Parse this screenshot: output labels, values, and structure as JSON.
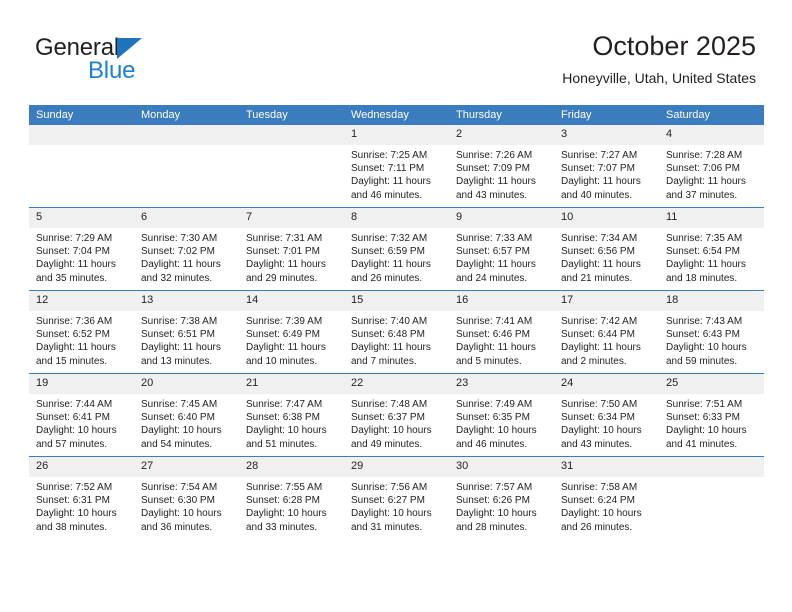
{
  "brand": {
    "name_part1": "General",
    "name_part2": "Blue",
    "logo_color": "#1b82d2"
  },
  "header": {
    "title": "October 2025",
    "subtitle": "Honeyville, Utah, United States",
    "accent_color": "#3a7cbe"
  },
  "weekdays": [
    "Sunday",
    "Monday",
    "Tuesday",
    "Wednesday",
    "Thursday",
    "Friday",
    "Saturday"
  ],
  "weeks": [
    [
      {
        "day": "",
        "sunrise": "",
        "sunset": "",
        "daylight": "",
        "daylight2": ""
      },
      {
        "day": "",
        "sunrise": "",
        "sunset": "",
        "daylight": "",
        "daylight2": ""
      },
      {
        "day": "",
        "sunrise": "",
        "sunset": "",
        "daylight": "",
        "daylight2": ""
      },
      {
        "day": "1",
        "sunrise": "Sunrise: 7:25 AM",
        "sunset": "Sunset: 7:11 PM",
        "daylight": "Daylight: 11 hours",
        "daylight2": "and 46 minutes."
      },
      {
        "day": "2",
        "sunrise": "Sunrise: 7:26 AM",
        "sunset": "Sunset: 7:09 PM",
        "daylight": "Daylight: 11 hours",
        "daylight2": "and 43 minutes."
      },
      {
        "day": "3",
        "sunrise": "Sunrise: 7:27 AM",
        "sunset": "Sunset: 7:07 PM",
        "daylight": "Daylight: 11 hours",
        "daylight2": "and 40 minutes."
      },
      {
        "day": "4",
        "sunrise": "Sunrise: 7:28 AM",
        "sunset": "Sunset: 7:06 PM",
        "daylight": "Daylight: 11 hours",
        "daylight2": "and 37 minutes."
      }
    ],
    [
      {
        "day": "5",
        "sunrise": "Sunrise: 7:29 AM",
        "sunset": "Sunset: 7:04 PM",
        "daylight": "Daylight: 11 hours",
        "daylight2": "and 35 minutes."
      },
      {
        "day": "6",
        "sunrise": "Sunrise: 7:30 AM",
        "sunset": "Sunset: 7:02 PM",
        "daylight": "Daylight: 11 hours",
        "daylight2": "and 32 minutes."
      },
      {
        "day": "7",
        "sunrise": "Sunrise: 7:31 AM",
        "sunset": "Sunset: 7:01 PM",
        "daylight": "Daylight: 11 hours",
        "daylight2": "and 29 minutes."
      },
      {
        "day": "8",
        "sunrise": "Sunrise: 7:32 AM",
        "sunset": "Sunset: 6:59 PM",
        "daylight": "Daylight: 11 hours",
        "daylight2": "and 26 minutes."
      },
      {
        "day": "9",
        "sunrise": "Sunrise: 7:33 AM",
        "sunset": "Sunset: 6:57 PM",
        "daylight": "Daylight: 11 hours",
        "daylight2": "and 24 minutes."
      },
      {
        "day": "10",
        "sunrise": "Sunrise: 7:34 AM",
        "sunset": "Sunset: 6:56 PM",
        "daylight": "Daylight: 11 hours",
        "daylight2": "and 21 minutes."
      },
      {
        "day": "11",
        "sunrise": "Sunrise: 7:35 AM",
        "sunset": "Sunset: 6:54 PM",
        "daylight": "Daylight: 11 hours",
        "daylight2": "and 18 minutes."
      }
    ],
    [
      {
        "day": "12",
        "sunrise": "Sunrise: 7:36 AM",
        "sunset": "Sunset: 6:52 PM",
        "daylight": "Daylight: 11 hours",
        "daylight2": "and 15 minutes."
      },
      {
        "day": "13",
        "sunrise": "Sunrise: 7:38 AM",
        "sunset": "Sunset: 6:51 PM",
        "daylight": "Daylight: 11 hours",
        "daylight2": "and 13 minutes."
      },
      {
        "day": "14",
        "sunrise": "Sunrise: 7:39 AM",
        "sunset": "Sunset: 6:49 PM",
        "daylight": "Daylight: 11 hours",
        "daylight2": "and 10 minutes."
      },
      {
        "day": "15",
        "sunrise": "Sunrise: 7:40 AM",
        "sunset": "Sunset: 6:48 PM",
        "daylight": "Daylight: 11 hours",
        "daylight2": "and 7 minutes."
      },
      {
        "day": "16",
        "sunrise": "Sunrise: 7:41 AM",
        "sunset": "Sunset: 6:46 PM",
        "daylight": "Daylight: 11 hours",
        "daylight2": "and 5 minutes."
      },
      {
        "day": "17",
        "sunrise": "Sunrise: 7:42 AM",
        "sunset": "Sunset: 6:44 PM",
        "daylight": "Daylight: 11 hours",
        "daylight2": "and 2 minutes."
      },
      {
        "day": "18",
        "sunrise": "Sunrise: 7:43 AM",
        "sunset": "Sunset: 6:43 PM",
        "daylight": "Daylight: 10 hours",
        "daylight2": "and 59 minutes."
      }
    ],
    [
      {
        "day": "19",
        "sunrise": "Sunrise: 7:44 AM",
        "sunset": "Sunset: 6:41 PM",
        "daylight": "Daylight: 10 hours",
        "daylight2": "and 57 minutes."
      },
      {
        "day": "20",
        "sunrise": "Sunrise: 7:45 AM",
        "sunset": "Sunset: 6:40 PM",
        "daylight": "Daylight: 10 hours",
        "daylight2": "and 54 minutes."
      },
      {
        "day": "21",
        "sunrise": "Sunrise: 7:47 AM",
        "sunset": "Sunset: 6:38 PM",
        "daylight": "Daylight: 10 hours",
        "daylight2": "and 51 minutes."
      },
      {
        "day": "22",
        "sunrise": "Sunrise: 7:48 AM",
        "sunset": "Sunset: 6:37 PM",
        "daylight": "Daylight: 10 hours",
        "daylight2": "and 49 minutes."
      },
      {
        "day": "23",
        "sunrise": "Sunrise: 7:49 AM",
        "sunset": "Sunset: 6:35 PM",
        "daylight": "Daylight: 10 hours",
        "daylight2": "and 46 minutes."
      },
      {
        "day": "24",
        "sunrise": "Sunrise: 7:50 AM",
        "sunset": "Sunset: 6:34 PM",
        "daylight": "Daylight: 10 hours",
        "daylight2": "and 43 minutes."
      },
      {
        "day": "25",
        "sunrise": "Sunrise: 7:51 AM",
        "sunset": "Sunset: 6:33 PM",
        "daylight": "Daylight: 10 hours",
        "daylight2": "and 41 minutes."
      }
    ],
    [
      {
        "day": "26",
        "sunrise": "Sunrise: 7:52 AM",
        "sunset": "Sunset: 6:31 PM",
        "daylight": "Daylight: 10 hours",
        "daylight2": "and 38 minutes."
      },
      {
        "day": "27",
        "sunrise": "Sunrise: 7:54 AM",
        "sunset": "Sunset: 6:30 PM",
        "daylight": "Daylight: 10 hours",
        "daylight2": "and 36 minutes."
      },
      {
        "day": "28",
        "sunrise": "Sunrise: 7:55 AM",
        "sunset": "Sunset: 6:28 PM",
        "daylight": "Daylight: 10 hours",
        "daylight2": "and 33 minutes."
      },
      {
        "day": "29",
        "sunrise": "Sunrise: 7:56 AM",
        "sunset": "Sunset: 6:27 PM",
        "daylight": "Daylight: 10 hours",
        "daylight2": "and 31 minutes."
      },
      {
        "day": "30",
        "sunrise": "Sunrise: 7:57 AM",
        "sunset": "Sunset: 6:26 PM",
        "daylight": "Daylight: 10 hours",
        "daylight2": "and 28 minutes."
      },
      {
        "day": "31",
        "sunrise": "Sunrise: 7:58 AM",
        "sunset": "Sunset: 6:24 PM",
        "daylight": "Daylight: 10 hours",
        "daylight2": "and 26 minutes."
      },
      {
        "day": "",
        "sunrise": "",
        "sunset": "",
        "daylight": "",
        "daylight2": ""
      }
    ]
  ]
}
